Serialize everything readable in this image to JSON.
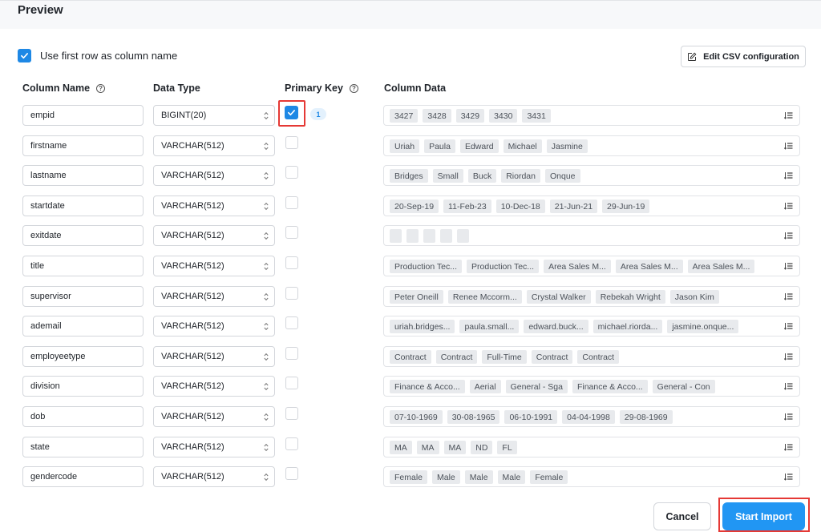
{
  "header": {
    "title": "Preview"
  },
  "options": {
    "first_row_label": "Use first row as column name",
    "first_row_checked": true,
    "edit_csv_label": "Edit CSV configuration"
  },
  "columns_header": {
    "name": "Column Name",
    "type": "Data Type",
    "pk": "Primary Key",
    "data": "Column Data"
  },
  "rows": [
    {
      "name": "empid",
      "type": "BIGINT(20)",
      "pk": true,
      "pk_badge": "1",
      "data": [
        "3427",
        "3428",
        "3429",
        "3430",
        "3431"
      ]
    },
    {
      "name": "firstname",
      "type": "VARCHAR(512)",
      "pk": false,
      "data": [
        "Uriah",
        "Paula",
        "Edward",
        "Michael",
        "Jasmine"
      ]
    },
    {
      "name": "lastname",
      "type": "VARCHAR(512)",
      "pk": false,
      "data": [
        "Bridges",
        "Small",
        "Buck",
        "Riordan",
        "Onque"
      ]
    },
    {
      "name": "startdate",
      "type": "VARCHAR(512)",
      "pk": false,
      "data": [
        "20-Sep-19",
        "11-Feb-23",
        "10-Dec-18",
        "21-Jun-21",
        "29-Jun-19"
      ]
    },
    {
      "name": "exitdate",
      "type": "VARCHAR(512)",
      "pk": false,
      "data": [
        "",
        "",
        "",
        "",
        ""
      ]
    },
    {
      "name": "title",
      "type": "VARCHAR(512)",
      "pk": false,
      "data": [
        "Production Tec...",
        "Production Tec...",
        "Area Sales M...",
        "Area Sales M...",
        "Area Sales M..."
      ]
    },
    {
      "name": "supervisor",
      "type": "VARCHAR(512)",
      "pk": false,
      "data": [
        "Peter Oneill",
        "Renee Mccorm...",
        "Crystal Walker",
        "Rebekah Wright",
        "Jason Kim"
      ]
    },
    {
      "name": "ademail",
      "type": "VARCHAR(512)",
      "pk": false,
      "data": [
        "uriah.bridges...",
        "paula.small...",
        "edward.buck...",
        "michael.riorda...",
        "jasmine.onque..."
      ]
    },
    {
      "name": "employeetype",
      "type": "VARCHAR(512)",
      "pk": false,
      "data": [
        "Contract",
        "Contract",
        "Full-Time",
        "Contract",
        "Contract"
      ]
    },
    {
      "name": "division",
      "type": "VARCHAR(512)",
      "pk": false,
      "data": [
        "Finance & Acco...",
        "Aerial",
        "General - Sga",
        "Finance & Acco...",
        "General - Con"
      ]
    },
    {
      "name": "dob",
      "type": "VARCHAR(512)",
      "pk": false,
      "data": [
        "07-10-1969",
        "30-08-1965",
        "06-10-1991",
        "04-04-1998",
        "29-08-1969"
      ]
    },
    {
      "name": "state",
      "type": "VARCHAR(512)",
      "pk": false,
      "data": [
        "MA",
        "MA",
        "MA",
        "ND",
        "FL"
      ]
    },
    {
      "name": "gendercode",
      "type": "VARCHAR(512)",
      "pk": false,
      "data": [
        "Female",
        "Male",
        "Male",
        "Male",
        "Female"
      ]
    }
  ],
  "footer": {
    "cancel_label": "Cancel",
    "start_label": "Start Import"
  },
  "icons": {
    "help": "help-circle-icon",
    "edit": "pencil-square-icon",
    "caret": "up-down-caret-icon",
    "list": "sort-list-icon",
    "check": "checkmark-icon"
  },
  "colors": {
    "accent": "#1e88e5",
    "primary_button": "#2196f3",
    "highlight": "#e53935"
  }
}
